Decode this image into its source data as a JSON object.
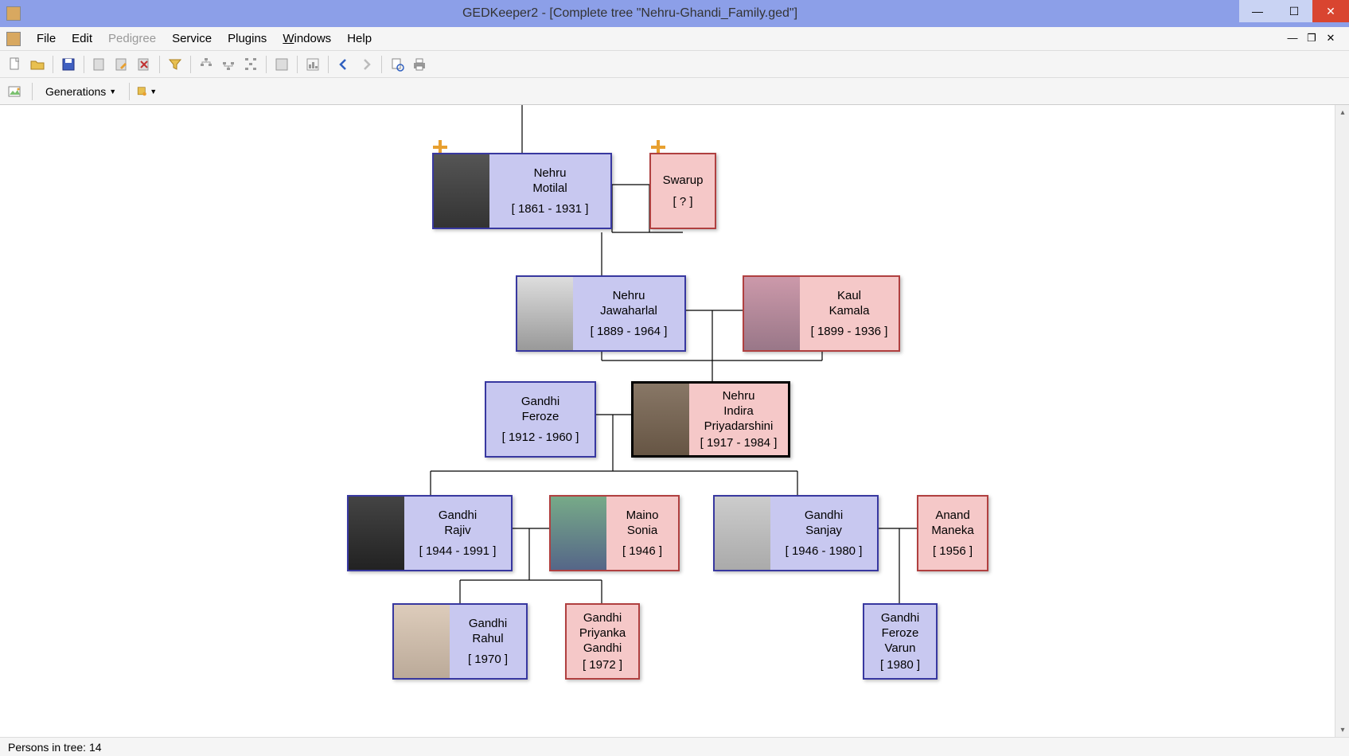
{
  "window_title": "GEDKeeper2 - [Complete tree \"Nehru-Ghandi_Family.ged\"]",
  "menu": {
    "file": "File",
    "edit": "Edit",
    "pedigree": "Pedigree",
    "service": "Service",
    "plugins": "Plugins",
    "windows": "Windows",
    "help": "Help"
  },
  "toolbar2": {
    "generations": "Generations"
  },
  "tree": {
    "motilal": {
      "line1": "Nehru",
      "line2": "Motilal",
      "dates": "[ 1861 - 1931 ]"
    },
    "swarup": {
      "line1": "Swarup",
      "dates": "[ ? ]"
    },
    "jawaharlal": {
      "line1": "Nehru",
      "line2": "Jawaharlal",
      "dates": "[ 1889 - 1964 ]"
    },
    "kamala": {
      "line1": "Kaul",
      "line2": "Kamala",
      "dates": "[ 1899 - 1936 ]"
    },
    "feroze": {
      "line1": "Gandhi",
      "line2": "Feroze",
      "dates": "[ 1912 - 1960 ]"
    },
    "indira": {
      "line1": "Nehru",
      "line2": "Indira",
      "line3": "Priyadarshini",
      "dates": "[ 1917 - 1984 ]"
    },
    "rajiv": {
      "line1": "Gandhi",
      "line2": "Rajiv",
      "dates": "[ 1944 - 1991 ]"
    },
    "sonia": {
      "line1": "Maino",
      "line2": "Sonia",
      "dates": "[ 1946 ]"
    },
    "sanjay": {
      "line1": "Gandhi",
      "line2": "Sanjay",
      "dates": "[ 1946 - 1980 ]"
    },
    "maneka": {
      "line1": "Anand",
      "line2": "Maneka",
      "dates": "[ 1956 ]"
    },
    "rahul": {
      "line1": "Gandhi",
      "line2": "Rahul",
      "dates": "[ 1970 ]"
    },
    "priyanka": {
      "line1": "Gandhi",
      "line2": "Priyanka",
      "line3": "Gandhi",
      "dates": "[ 1972 ]"
    },
    "varun": {
      "line1": "Gandhi",
      "line2": "Feroze",
      "line3": "Varun",
      "dates": "[ 1980 ]"
    }
  },
  "status": {
    "persons": "Persons in tree: 14"
  }
}
